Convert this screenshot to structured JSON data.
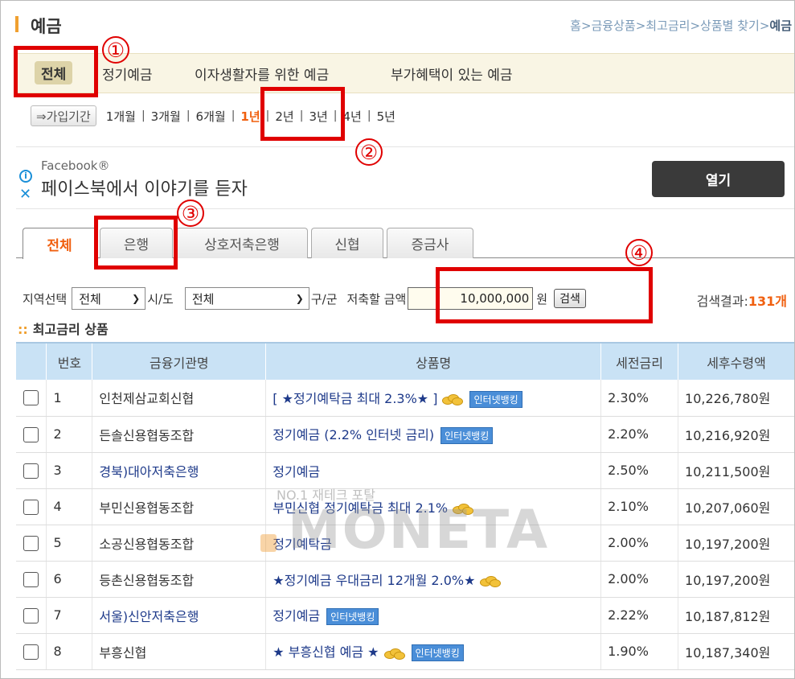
{
  "header": {
    "title": "예금",
    "breadcrumb": "홈>금융상품>최고금리>상품별 찾기>",
    "breadcrumb_current": "예금"
  },
  "categories": [
    {
      "label": "전체",
      "selected": true
    },
    {
      "label": "정기예금"
    },
    {
      "label": "이자생활자를 위한 예금"
    },
    {
      "label": "부가혜택이 있는 예금"
    }
  ],
  "period": {
    "button_label": "⇒가입기간",
    "options": [
      "1개월",
      "3개월",
      "6개월",
      "1년",
      "2년",
      "3년",
      "4년",
      "5년"
    ],
    "selected": "1년"
  },
  "ad": {
    "brand": "Facebook®",
    "message": "페이스북에서 이야기를 듣자",
    "open_label": "열기"
  },
  "tabs": [
    {
      "label": "전체",
      "active": true
    },
    {
      "label": "은행"
    },
    {
      "label": "상호저축은행"
    },
    {
      "label": "신협"
    },
    {
      "label": "증금사"
    }
  ],
  "filter": {
    "region_label": "지역선택",
    "region_value": "전체",
    "sido_label": "시/도",
    "district_value": "전체",
    "gugun_label": "구/군",
    "amount_label": "저축할 금액",
    "amount_value": "10,000,000",
    "unit_label": "원",
    "search_label": "검색",
    "result_label": "검색결과:",
    "result_count": "131개"
  },
  "section_title": "최고금리 상품",
  "table": {
    "headers": [
      "번호",
      "금융기관명",
      "상품명",
      "세전금리",
      "세후수령액"
    ],
    "rows": [
      {
        "no": "1",
        "inst": "인천제삼교회신협",
        "product": "[ ★정기예탁금 최대 2.3%★ ]",
        "coin": true,
        "ibank": true,
        "rate": "2.30%",
        "amount": "10,226,780원"
      },
      {
        "no": "2",
        "inst": "든솔신용협동조합",
        "product": "정기예금 (2.2% 인터넷 금리)",
        "coin": false,
        "ibank": true,
        "rate": "2.20%",
        "amount": "10,216,920원"
      },
      {
        "no": "3",
        "inst": "경북)대아저축은행",
        "inst_link": true,
        "product": "정기예금",
        "coin": false,
        "ibank": false,
        "rate": "2.50%",
        "amount": "10,211,500원"
      },
      {
        "no": "4",
        "inst": "부민신용협동조합",
        "product": "부민신협 정기예탁금 최대 2.1%",
        "coin": true,
        "ibank": false,
        "rate": "2.10%",
        "amount": "10,207,060원"
      },
      {
        "no": "5",
        "inst": "소공신용협동조합",
        "product": "정기예탁금",
        "coin": false,
        "ibank": false,
        "rate": "2.00%",
        "amount": "10,197,200원"
      },
      {
        "no": "6",
        "inst": "등촌신용협동조합",
        "product": "★정기예금 우대금리 12개월 2.0%★",
        "coin": true,
        "ibank": false,
        "rate": "2.00%",
        "amount": "10,197,200원"
      },
      {
        "no": "7",
        "inst": "서울)신안저축은행",
        "inst_link": true,
        "product": "정기예금",
        "coin": false,
        "ibank": true,
        "rate": "2.22%",
        "amount": "10,187,812원"
      },
      {
        "no": "8",
        "inst": "부흥신협",
        "product": "★ 부흥신협 예금 ★",
        "coin": true,
        "ibank": true,
        "rate": "1.90%",
        "amount": "10,187,340원"
      }
    ],
    "ibank_label": "인터넷뱅킹"
  },
  "watermark": {
    "small": "NO.1 재테크 포탈",
    "big": "MONETA"
  },
  "annotations": [
    "①",
    "②",
    "③",
    "④"
  ],
  "colors": {
    "accent": "#f06010",
    "annotation": "#e00000",
    "table_header": "#c9e2f5",
    "category_bg": "#f9f5e4"
  }
}
